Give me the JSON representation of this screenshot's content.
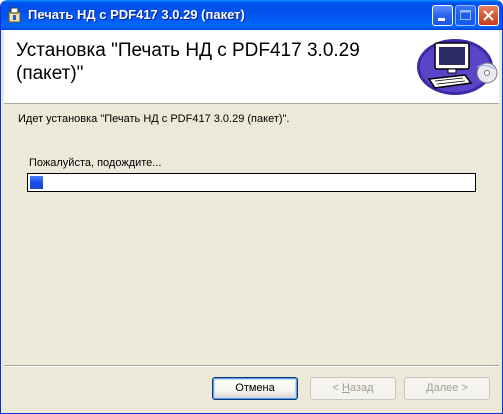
{
  "window": {
    "title": "Печать НД с PDF417 3.0.29 (пакет)"
  },
  "banner": {
    "title": "Установка \"Печать НД с PDF417 3.0.29 (пакет)\""
  },
  "content": {
    "status_text": "Идет установка \"Печать НД с PDF417 3.0.29 (пакет)\".",
    "wait_text": "Пожалуйста, подождите...",
    "progress_fraction": 0.03
  },
  "buttons": {
    "cancel": "Отмена",
    "back_mnemonic": "Н",
    "back_rest": "азад",
    "back_prefix": "< ",
    "next_mnemonic": "Д",
    "next_rest": "алее >"
  },
  "colors": {
    "titlebar": "#0054e3",
    "progress": "#1a4ee6",
    "dialog_bg": "#ece9d8"
  }
}
